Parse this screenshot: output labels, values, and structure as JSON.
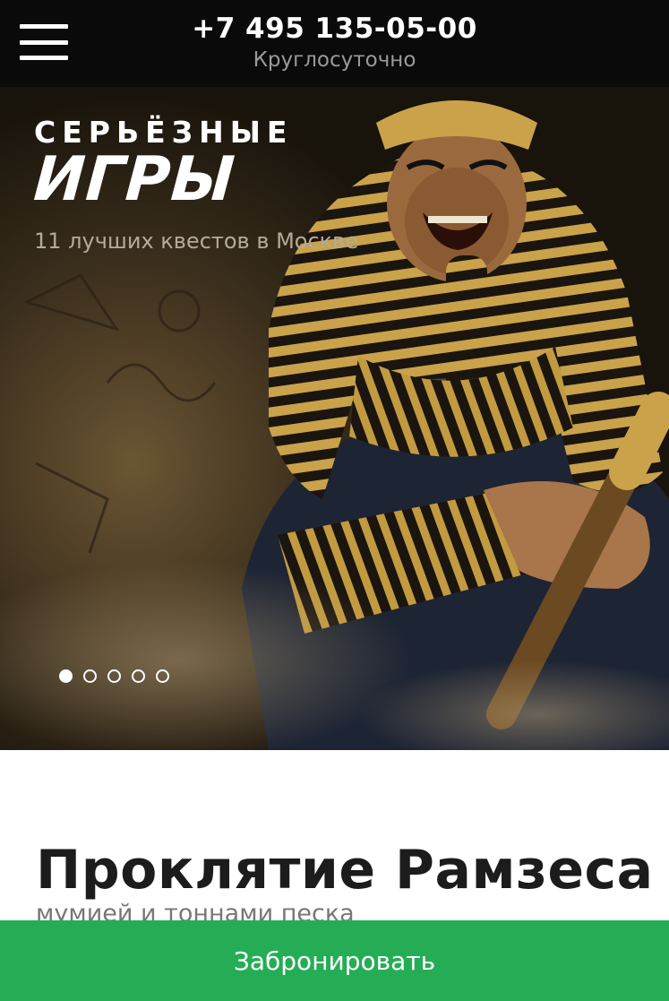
{
  "header": {
    "phone": "+7 495 135-05-00",
    "hours": "Круглосуточно"
  },
  "hero": {
    "logo_top": "СЕРЬЁЗНЫЕ",
    "logo_bottom": "ИГРЫ",
    "tagline": "11 лучших квестов в Москве",
    "slides_total": 5,
    "active_slide": 1
  },
  "quest": {
    "title": "Проклятие Рамзеса",
    "description_partial": "мумией и тоннами песка"
  },
  "cta": {
    "label": "Забронировать"
  },
  "colors": {
    "topbar_bg": "#0a0a0a",
    "cta_bg": "#25ad55",
    "gold": "#c9a24a"
  }
}
